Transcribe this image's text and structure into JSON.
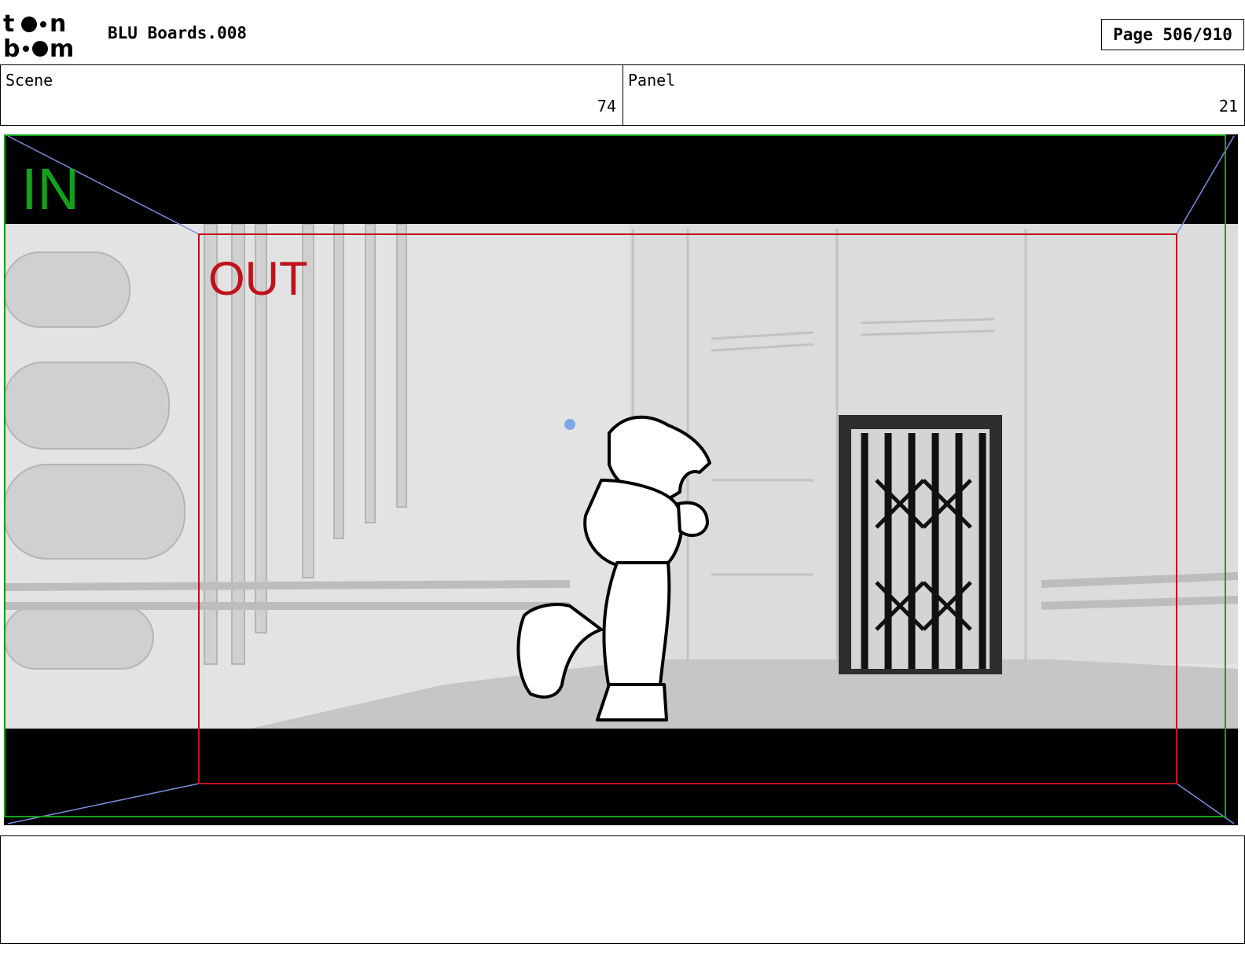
{
  "header": {
    "logo_text": "toon boom",
    "document_title": "BLU Boards.008",
    "page_indicator": "Page 506/910"
  },
  "meta": {
    "scene_label": "Scene",
    "scene_value": "74",
    "panel_label": "Panel",
    "panel_value": "21"
  },
  "frame": {
    "in_label": "IN",
    "out_label": "OUT",
    "in_color": "#11a31a",
    "out_color": "#c0121a",
    "guide_color": "#7a8fe0"
  },
  "notes": {
    "text": ""
  }
}
